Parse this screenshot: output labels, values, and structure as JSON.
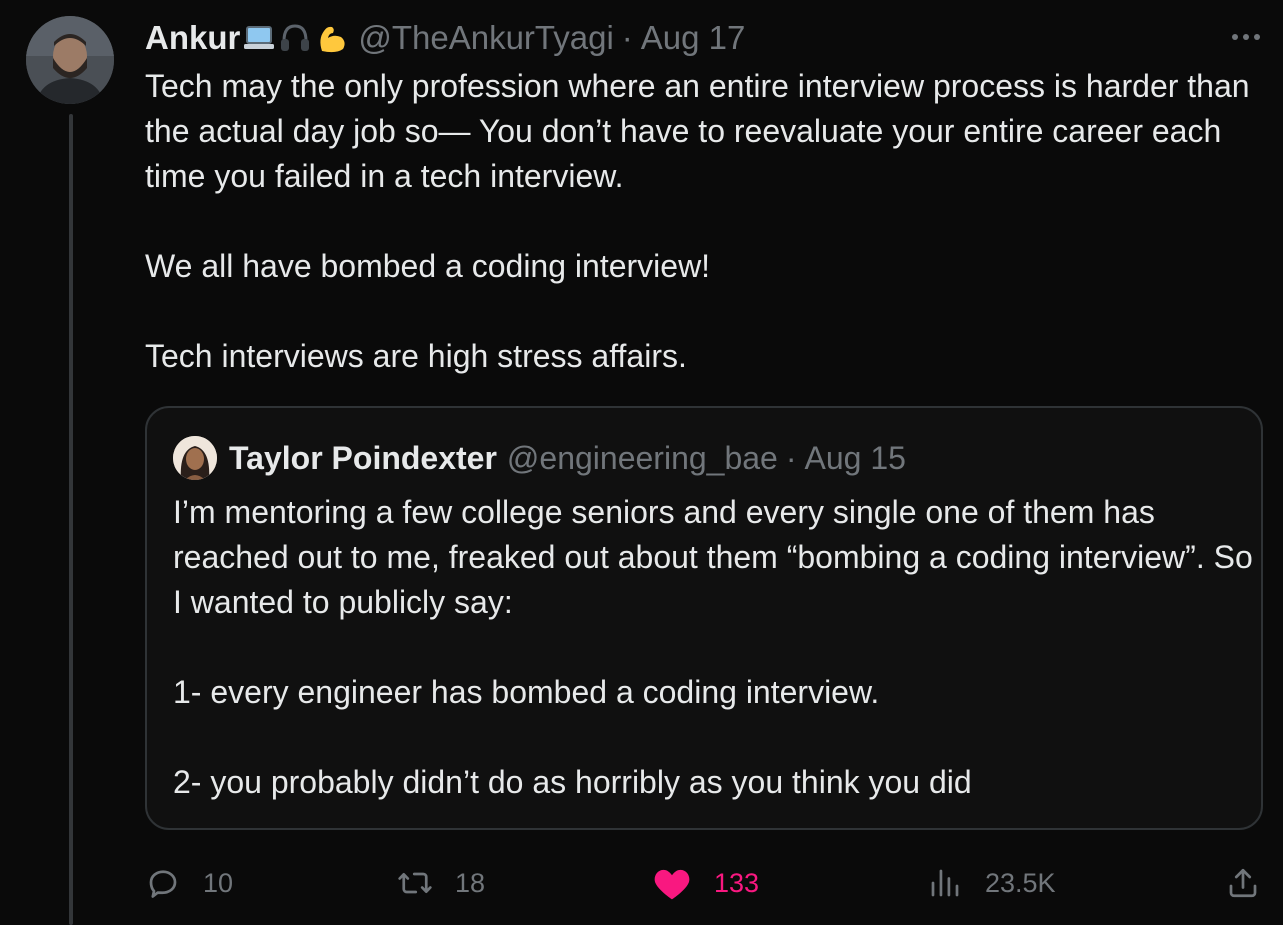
{
  "tweet": {
    "author_name": "Ankur",
    "author_emojis": [
      "laptop-emoji",
      "headphones-emoji",
      "flexed-biceps-emoji"
    ],
    "handle": "@TheAnkurTyagi",
    "separator": "·",
    "date": "Aug 17",
    "paragraphs": [
      "Tech may the only profession where an entire interview process is harder than the actual day job so— You don’t have to reevaluate your entire career each time you failed in a tech interview.",
      "We all have bombed a coding interview!",
      "Tech interviews are high stress affairs."
    ],
    "more_icon": "more-horizontal-icon"
  },
  "quoted_tweet": {
    "author_name": "Taylor Poindexter",
    "handle": "@engineering_bae",
    "separator": "·",
    "date": "Aug 15",
    "paragraphs": [
      "I’m mentoring a few college seniors and every single one of them has reached out to me, freaked out about them “bombing a coding interview”. So I wanted to publicly say:",
      "1- every engineer has bombed a coding interview.",
      "2- you probably didn’t do as horribly as you think you did"
    ]
  },
  "actions": {
    "replies": "10",
    "retweets": "18",
    "likes": "133",
    "views": "23.5K"
  },
  "colors": {
    "background": "#0a0a0a",
    "text": "#e7e9ea",
    "secondary": "#71767b",
    "like": "#f91880",
    "border": "#2f3336"
  }
}
